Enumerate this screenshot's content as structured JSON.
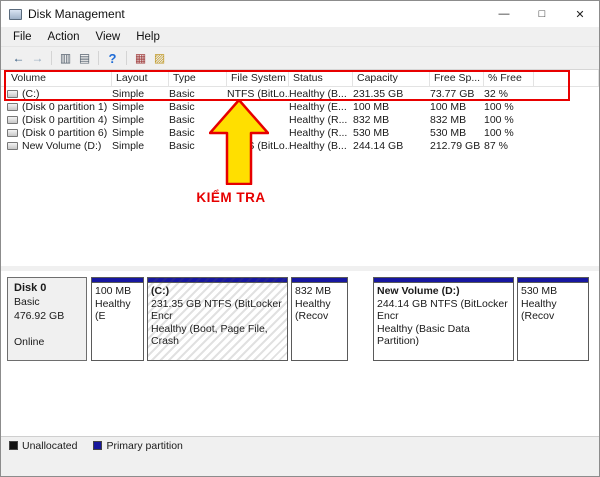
{
  "window": {
    "title": "Disk Management",
    "controls": {
      "minimize": "—",
      "maximize": "□",
      "close": "✕"
    }
  },
  "menu": {
    "items": [
      "File",
      "Action",
      "View",
      "Help"
    ]
  },
  "toolbar": {
    "icons": [
      {
        "name": "back",
        "glyph": "←"
      },
      {
        "name": "forward",
        "glyph": "→"
      },
      {
        "name": "show-console-tree",
        "glyph": "▥"
      },
      {
        "name": "properties",
        "glyph": "▤"
      },
      {
        "name": "help",
        "glyph": "?"
      },
      {
        "name": "disk-action",
        "glyph": "▦"
      },
      {
        "name": "view-action",
        "glyph": "▨"
      }
    ]
  },
  "volume_list": {
    "columns": [
      "Volume",
      "Layout",
      "Type",
      "File System",
      "Status",
      "Capacity",
      "Free Sp...",
      "% Free"
    ],
    "rows": [
      {
        "volume": "(C:)",
        "layout": "Simple",
        "type": "Basic",
        "file_system": "NTFS (BitLo...",
        "status": "Healthy (B...",
        "capacity": "231.35 GB",
        "free_space": "73.77 GB",
        "pct_free": "32 %"
      },
      {
        "volume": "(Disk 0 partition 1)",
        "layout": "Simple",
        "type": "Basic",
        "file_system": "",
        "status": "Healthy (E...",
        "capacity": "100 MB",
        "free_space": "100 MB",
        "pct_free": "100 %"
      },
      {
        "volume": "(Disk 0 partition 4)",
        "layout": "Simple",
        "type": "Basic",
        "file_system": "",
        "status": "Healthy (R...",
        "capacity": "832 MB",
        "free_space": "832 MB",
        "pct_free": "100 %"
      },
      {
        "volume": "(Disk 0 partition 6)",
        "layout": "Simple",
        "type": "Basic",
        "file_system": "",
        "status": "Healthy (R...",
        "capacity": "530 MB",
        "free_space": "530 MB",
        "pct_free": "100 %"
      },
      {
        "volume": "New Volume (D:)",
        "layout": "Simple",
        "type": "Basic",
        "file_system": "NTFS (BitLo...",
        "status": "Healthy (B...",
        "capacity": "244.14 GB",
        "free_space": "212.79 GB",
        "pct_free": "87 %"
      }
    ]
  },
  "annotation": {
    "label": "KIỂM TRA",
    "outline_color": "#e60000",
    "arrow_fill": "#ffdf00"
  },
  "disk0": {
    "name": "Disk 0",
    "type": "Basic",
    "size": "476.92 GB",
    "status": "Online",
    "partitions": [
      {
        "size": "100 MB",
        "status": "Healthy (E"
      },
      {
        "name": "(C:)",
        "detail": "231.35 GB NTFS (BitLocker Encr",
        "status": "Healthy (Boot, Page File, Crash"
      },
      {
        "size": "832 MB",
        "status": "Healthy (Recov"
      },
      {
        "name": "New Volume (D:)",
        "detail": "244.14 GB NTFS (BitLocker Encr",
        "status": "Healthy (Basic Data Partition)"
      },
      {
        "size": "530 MB",
        "status": "Healthy (Recov"
      }
    ]
  },
  "legend": {
    "items": [
      {
        "label": "Unallocated",
        "color": "#111111"
      },
      {
        "label": "Primary partition",
        "color": "#17179c"
      }
    ]
  }
}
